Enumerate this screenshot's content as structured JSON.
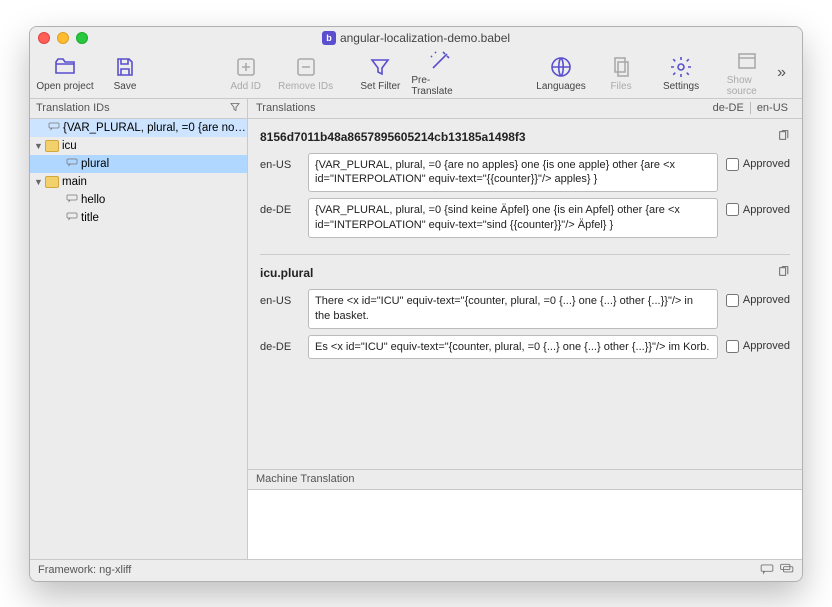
{
  "window": {
    "title": "angular-localization-demo.babel"
  },
  "toolbar": {
    "open": "Open project",
    "save": "Save",
    "add_id": "Add ID",
    "remove_ids": "Remove IDs",
    "set_filter": "Set Filter",
    "pre_translate": "Pre-Translate",
    "languages": "Languages",
    "files": "Files",
    "settings": "Settings",
    "show_source": "Show source"
  },
  "sidebar": {
    "header": "Translation IDs",
    "rows": [
      {
        "icon": "msg",
        "label": "{VAR_PLURAL, plural, =0 {are no…",
        "indent": 0,
        "selected": "light"
      },
      {
        "icon": "folder",
        "label": "icu",
        "indent": 0,
        "disclosure": true
      },
      {
        "icon": "msg",
        "label": "plural",
        "indent": 2,
        "selected": "strong"
      },
      {
        "icon": "folder",
        "label": "main",
        "indent": 0,
        "disclosure": true
      },
      {
        "icon": "msg",
        "label": "hello",
        "indent": 2
      },
      {
        "icon": "msg",
        "label": "title",
        "indent": 2
      }
    ]
  },
  "translations": {
    "header": "Translations",
    "locales": [
      "de-DE",
      "en-US"
    ],
    "entries": [
      {
        "title": "8156d7011b48a8657895605214cb13185a1498f3",
        "rows": [
          {
            "locale": "en-US",
            "text": "{VAR_PLURAL, plural, =0 {are no apples} one {is one apple} other {are <x id=\"INTERPOLATION\" equiv-text=\"{{counter}}\"/> apples} }",
            "approved": "Approved"
          },
          {
            "locale": "de-DE",
            "text": "{VAR_PLURAL, plural, =0 {sind keine Äpfel} one {is ein Apfel} other {are <x id=\"INTERPOLATION\" equiv-text=\"sind {{counter}}\"/> Äpfel} }",
            "approved": "Approved"
          }
        ]
      },
      {
        "title": "icu.plural",
        "rows": [
          {
            "locale": "en-US",
            "text": "There <x id=\"ICU\" equiv-text=\"{counter, plural, =0 {...} one {...} other {...}}\"/> in the basket.",
            "approved": "Approved"
          },
          {
            "locale": "de-DE",
            "text": "Es <x id=\"ICU\" equiv-text=\"{counter, plural, =0 {...} one {...} other {...}}\"/> im Korb.",
            "approved": "Approved"
          }
        ]
      }
    ]
  },
  "machine_translation": {
    "header": "Machine Translation"
  },
  "status": {
    "framework": "Framework: ng-xliff"
  }
}
